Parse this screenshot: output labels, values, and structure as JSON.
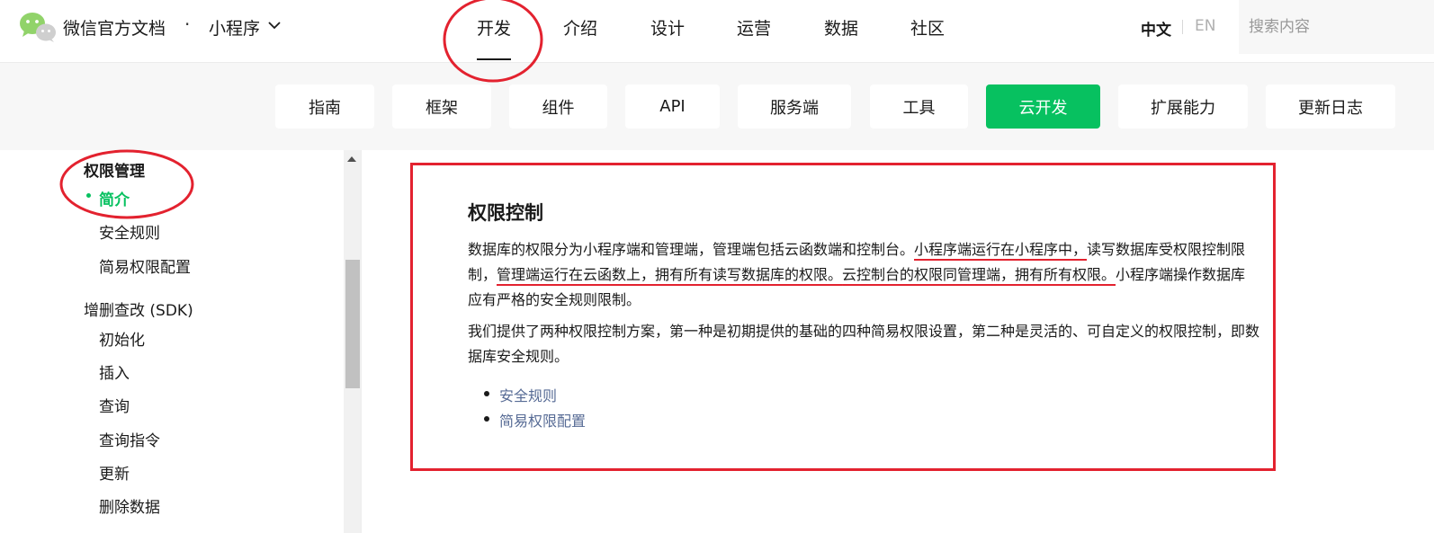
{
  "header": {
    "brand": "微信官方文档",
    "separator": "·",
    "product": "小程序",
    "nav": [
      {
        "label": "开发",
        "active": true
      },
      {
        "label": "介绍"
      },
      {
        "label": "设计"
      },
      {
        "label": "运营"
      },
      {
        "label": "数据"
      },
      {
        "label": "社区"
      }
    ],
    "lang_zh": "中文",
    "lang_en": "EN",
    "search_placeholder": "搜索内容"
  },
  "subnav": [
    {
      "label": "指南"
    },
    {
      "label": "框架"
    },
    {
      "label": "组件"
    },
    {
      "label": "API"
    },
    {
      "label": "服务端"
    },
    {
      "label": "工具"
    },
    {
      "label": "云开发",
      "active": true
    },
    {
      "label": "扩展能力"
    },
    {
      "label": "更新日志"
    }
  ],
  "sidebar": {
    "section_1": "权限管理",
    "items_1": [
      "简介",
      "安全规则",
      "简易权限配置"
    ],
    "section_2": "增删查改 (SDK)",
    "items_2": [
      "初始化",
      "插入",
      "查询",
      "查询指令",
      "更新",
      "删除数据"
    ]
  },
  "content": {
    "title": "权限控制",
    "p1": {
      "a": "数据库的权限分为小程序端和管理端，管理端包括云函数端和控制台。",
      "b": "小程序端运行在小程序中，",
      "c": "读写数据库受权限控制限制，",
      "d": "管理端运行在云函数上，拥有所有读写数据库的权限。",
      "e": "云控制台的权限同管理端，拥有所有权限。",
      "f": "小程序端操作数据库应有严格的安全规则限制。"
    },
    "p2": "我们提供了两种权限控制方案，第一种是初期提供的基础的四种简易权限设置，第二种是灵活的、可自定义的权限控制，即数据库安全规则。",
    "links": [
      "安全规则",
      "简易权限配置"
    ]
  },
  "colors": {
    "accent": "#07c160",
    "annotation": "#e3222f",
    "link": "#576b95"
  }
}
